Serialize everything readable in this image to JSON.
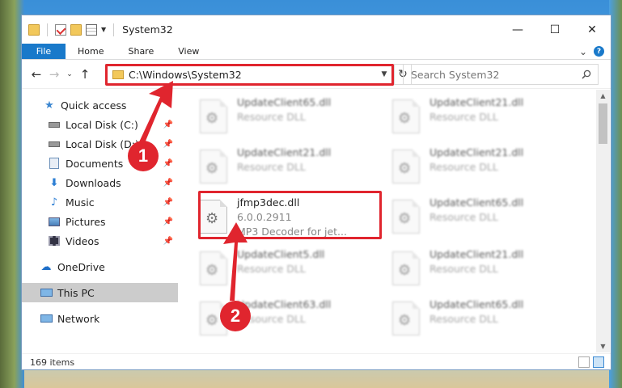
{
  "window": {
    "title": "System32",
    "minimize": "—",
    "maximize": "☐",
    "close": "✕"
  },
  "ribbon": {
    "tabs": [
      "File",
      "Home",
      "Share",
      "View"
    ],
    "collapse": "⌄",
    "help": "?"
  },
  "nav": {
    "back": "←",
    "forward": "→",
    "recent": "⌄",
    "up": "↑",
    "address": "C:\\Windows\\System32",
    "refresh": "↻",
    "search_placeholder": "Search System32"
  },
  "sidebar": {
    "items": [
      {
        "label": "Quick access",
        "icon": "star-icon",
        "pinned": false
      },
      {
        "label": "Local Disk (C:)",
        "icon": "drive-icon",
        "pinned": true
      },
      {
        "label": "Local Disk (D:)",
        "icon": "drive-icon",
        "pinned": true
      },
      {
        "label": "Documents",
        "icon": "documents-icon",
        "pinned": true
      },
      {
        "label": "Downloads",
        "icon": "download-icon",
        "pinned": true
      },
      {
        "label": "Music",
        "icon": "music-icon",
        "pinned": true
      },
      {
        "label": "Pictures",
        "icon": "pictures-icon",
        "pinned": true
      },
      {
        "label": "Videos",
        "icon": "videos-icon",
        "pinned": true
      },
      {
        "label": "OneDrive",
        "icon": "cloud-icon",
        "pinned": false
      },
      {
        "label": "This PC",
        "icon": "computer-icon",
        "pinned": false,
        "selected": true
      },
      {
        "label": "Network",
        "icon": "network-icon",
        "pinned": false
      }
    ],
    "pin_glyph": "📌"
  },
  "files": [
    {
      "name": "UpdateClient65.dll",
      "sub": "Resource DLL"
    },
    {
      "name": "UpdateClient21.dll",
      "sub": "Resource DLL"
    },
    {
      "name": "UpdateClient21.dll",
      "sub": "Resource DLL"
    },
    {
      "name": "UpdateClient21.dll",
      "sub": "Resource DLL"
    },
    {
      "name": "jfmp3dec.dll",
      "version": "6.0.0.2911",
      "sub": "MP3 Decoder for jet...",
      "focus": true
    },
    {
      "name": "UpdateClient65.dll",
      "sub": "Resource DLL"
    },
    {
      "name": "UpdateClient5.dll",
      "sub": "Resource DLL"
    },
    {
      "name": "UpdateClient21.dll",
      "sub": "Resource DLL"
    },
    {
      "name": "UpdateClient63.dll",
      "sub": "Resource DLL"
    },
    {
      "name": "UpdateClient65.dll",
      "sub": "Resource DLL"
    }
  ],
  "status": {
    "count": "169 items"
  },
  "annotations": {
    "badge1": "1",
    "badge2": "2",
    "color": "#e0252e"
  },
  "colors": {
    "accent": "#1979ca",
    "highlight": "#e0252e"
  }
}
